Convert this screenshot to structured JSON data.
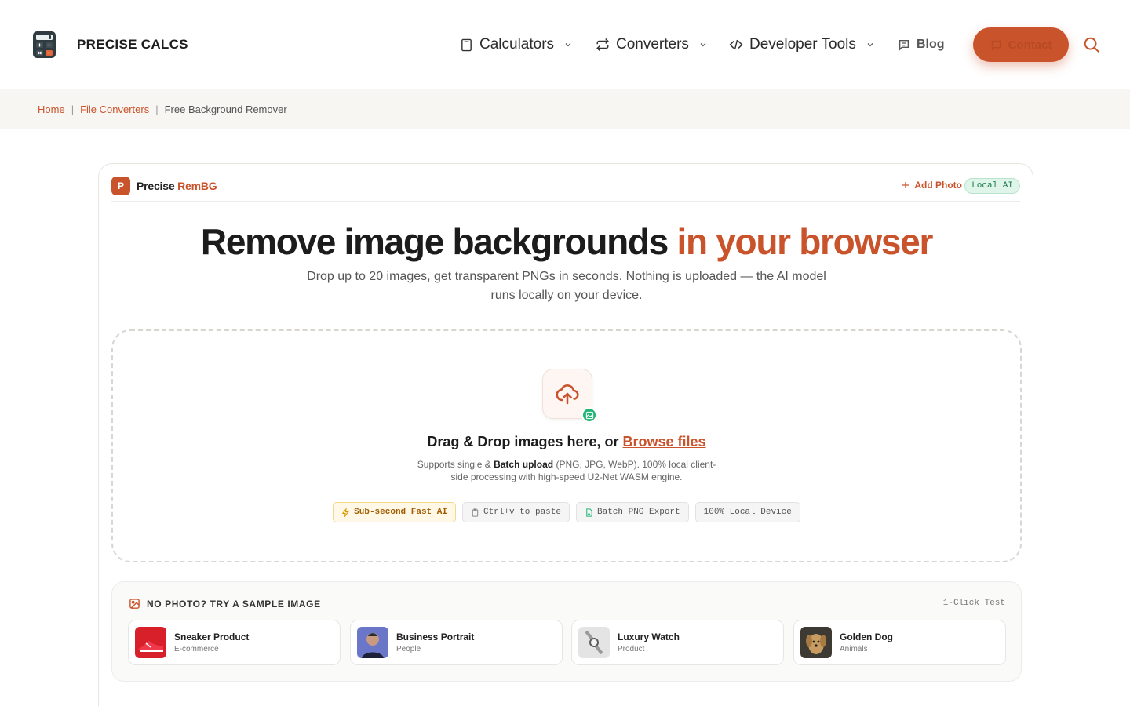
{
  "header": {
    "brand": "PRECISE CALCS",
    "nav": [
      {
        "label": "Calculators"
      },
      {
        "label": "Converters"
      },
      {
        "label": "Developer Tools"
      },
      {
        "label": "Blog"
      }
    ],
    "contact_label": "Contact"
  },
  "breadcrumb": {
    "home": "Home",
    "section": "File Converters",
    "current": "Free Background Remover"
  },
  "app": {
    "badge": "P",
    "name_prefix": "Precise",
    "name_accent": "RemBG",
    "add_photo": "Add Photo",
    "local_ai": "Local AI"
  },
  "hero": {
    "title_main": "Remove image backgrounds",
    "title_accent": "in your browser",
    "subtitle": "Drop up to 20 images, get transparent PNGs in seconds. Nothing is uploaded — the AI model runs locally on your device."
  },
  "dropzone": {
    "title_text": "Drag & Drop images here, or",
    "browse_label": "Browse files",
    "desc_prefix": "Supports single &",
    "desc_bold": "Batch upload",
    "desc_suffix": "(PNG, JPG, WebP). 100% local client-side processing with high-speed U2-Net WASM engine.",
    "chips": [
      {
        "label": "Sub-second Fast AI"
      },
      {
        "label": "Ctrl+v to paste"
      },
      {
        "label": "Batch PNG Export"
      },
      {
        "label": "100% Local Device"
      }
    ]
  },
  "samples": {
    "label": "NO PHOTO? TRY A SAMPLE IMAGE",
    "tag": "1-Click Test",
    "items": [
      {
        "name": "Sneaker Product",
        "category": "E-commerce"
      },
      {
        "name": "Business Portrait",
        "category": "People"
      },
      {
        "name": "Luxury Watch",
        "category": "Product"
      },
      {
        "name": "Golden Dog",
        "category": "Animals"
      }
    ]
  },
  "colors": {
    "accent": "#c9532b",
    "success": "#1fb574",
    "breadcrumb_bg": "#f8f6f3"
  }
}
